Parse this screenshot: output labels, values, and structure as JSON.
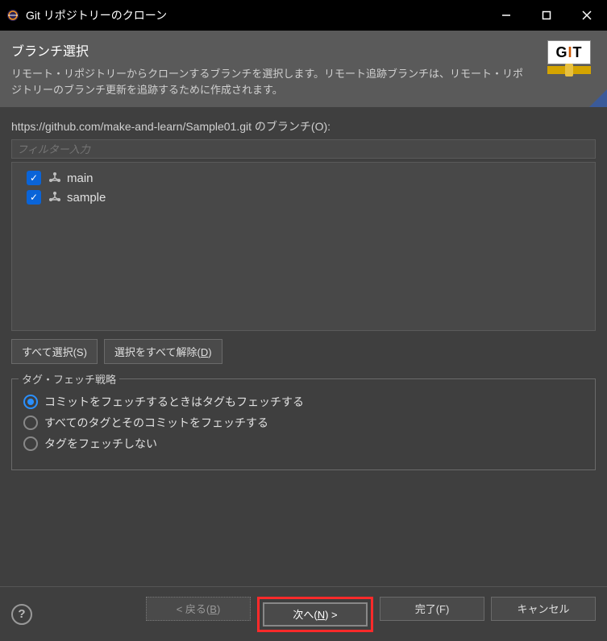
{
  "window": {
    "title": "Git リポジトリーのクローン"
  },
  "header": {
    "title": "ブランチ選択",
    "desc": "リモート・リポジトリーからクローンするブランチを選択します。リモート追跡ブランチは、リモート・リポジトリーのブランチ更新を追跡するために作成されます。"
  },
  "url_label": "https://github.com/make-and-learn/Sample01.git のブランチ(O):",
  "filter_placeholder": "フィルター入力",
  "branches": [
    {
      "name": "main",
      "checked": true
    },
    {
      "name": "sample",
      "checked": true
    }
  ],
  "buttons": {
    "select_all": "すべて選択(S)",
    "deselect_all_pre": "選択をすべて解除(",
    "deselect_all_key": "D",
    "deselect_all_post": ")"
  },
  "tag_strategy": {
    "legend": "タグ・フェッチ戦略",
    "options": [
      {
        "label": "コミットをフェッチするときはタグもフェッチする",
        "selected": true
      },
      {
        "label": "すべてのタグとそのコミットをフェッチする",
        "selected": false
      },
      {
        "label": "タグをフェッチしない",
        "selected": false
      }
    ]
  },
  "wizard": {
    "back_pre": "< 戻る(",
    "back_key": "B",
    "back_post": ")",
    "next_pre": "次へ(",
    "next_key": "N",
    "next_post": ") >",
    "finish": "完了(F)",
    "cancel": "キャンセル"
  }
}
